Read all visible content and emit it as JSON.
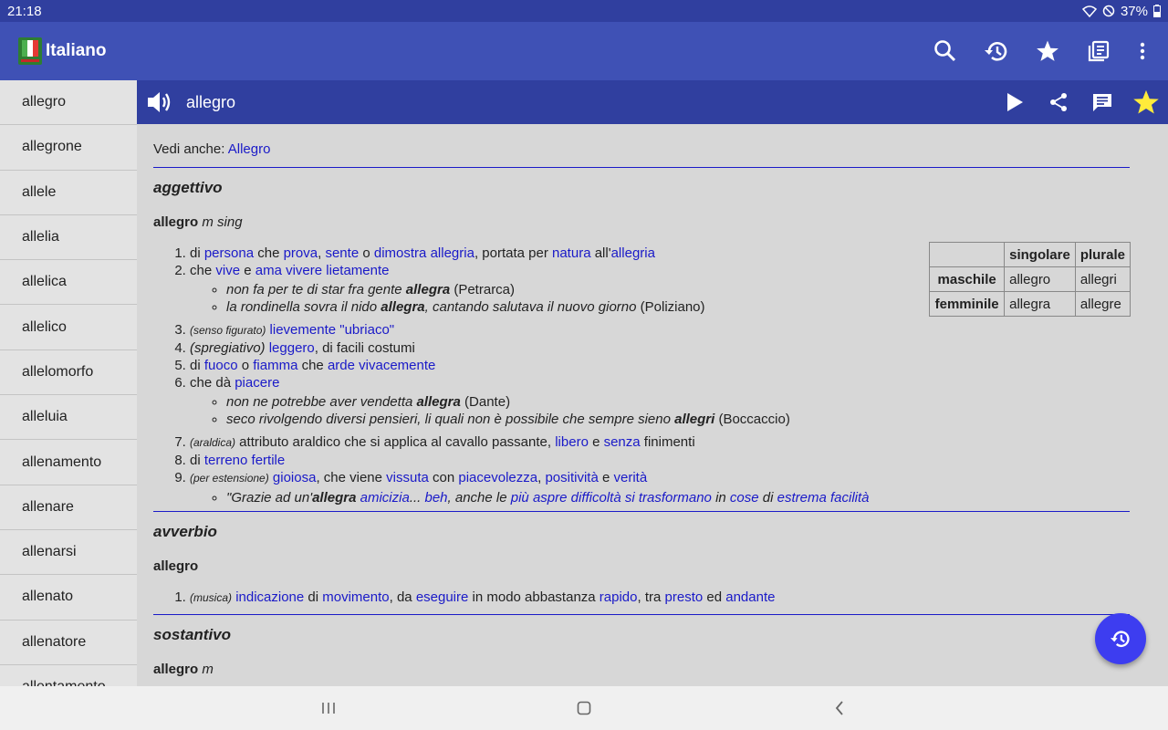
{
  "status": {
    "time": "21:18",
    "battery": "37%"
  },
  "app": {
    "title": "Italiano"
  },
  "sidebar": {
    "items": [
      {
        "label": "allegro"
      },
      {
        "label": "allegrone"
      },
      {
        "label": "allele"
      },
      {
        "label": "allelia"
      },
      {
        "label": "allelica"
      },
      {
        "label": "allelico"
      },
      {
        "label": "allelomorfo"
      },
      {
        "label": "alleluia"
      },
      {
        "label": "allenamento"
      },
      {
        "label": "allenare"
      },
      {
        "label": "allenarsi"
      },
      {
        "label": "allenato"
      },
      {
        "label": "allenatore"
      },
      {
        "label": "allentamento"
      }
    ]
  },
  "entry": {
    "word": "allegro",
    "see_also_label": "Vedi anche: ",
    "see_also_link": "Allegro",
    "adjective": {
      "pos": "aggettivo",
      "lemma": "allegro",
      "lemma_info": " m sing"
    },
    "adverb": {
      "pos": "avverbio",
      "lemma": "allegro"
    },
    "noun": {
      "pos": "sostantivo",
      "lemma": "allegro",
      "lemma_info": " m"
    }
  },
  "inflection": {
    "headers": [
      "",
      "singolare",
      "plurale"
    ],
    "rows": [
      {
        "label": "maschile",
        "sing": "allegro",
        "plur": "allegri"
      },
      {
        "label": "femminile",
        "sing": "allegra",
        "plur": "allegre"
      }
    ]
  },
  "colors": {
    "statusbar": "#303f9f",
    "appbar": "#3f51b5",
    "wordbar": "#303f9f",
    "link": "#1a1ac8",
    "fab": "#3d3df0",
    "star": "#ffeb3b"
  },
  "icons": [
    "search-icon",
    "history-icon",
    "star-icon",
    "book-list-icon",
    "more-vert-icon",
    "speaker-icon",
    "play-icon",
    "share-icon",
    "comment-icon",
    "star-filled-icon"
  ]
}
